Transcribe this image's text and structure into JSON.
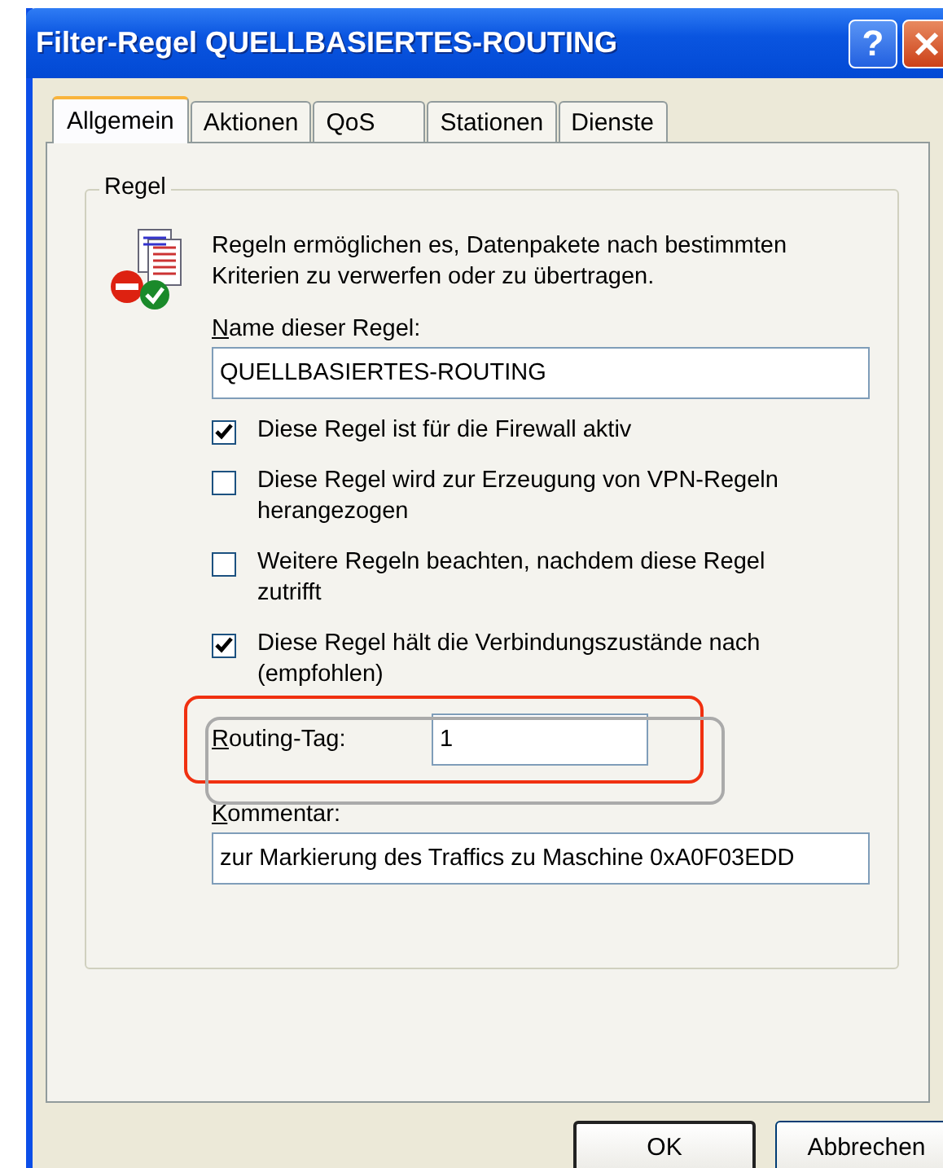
{
  "window": {
    "title": "Filter-Regel QUELLBASIERTES-ROUTING",
    "help": "?"
  },
  "tabs": [
    {
      "label": "Allgemein",
      "selected": true
    },
    {
      "label": "Aktionen",
      "selected": false
    },
    {
      "label": "QoS",
      "selected": false
    },
    {
      "label": "Stationen",
      "selected": false
    },
    {
      "label": "Dienste",
      "selected": false
    }
  ],
  "group": {
    "title": "Regel",
    "description": "Regeln ermöglichen es, Datenpakete nach bestimmten Kriterien zu verwerfen oder zu übertragen.",
    "name_field": {
      "label": "Name dieser Regel:",
      "value": "QUELLBASIERTES-ROUTING"
    },
    "checkboxes": [
      {
        "label": "Diese Regel ist für die Firewall aktiv",
        "checked": true
      },
      {
        "label": "Diese Regel wird zur Erzeugung von VPN-Regeln herangezogen",
        "checked": false
      },
      {
        "label": "Weitere Regeln beachten, nachdem diese Regel zutrifft",
        "checked": false
      },
      {
        "label": "Diese Regel hält die Verbindungszustände nach (empfohlen)",
        "checked": true
      }
    ],
    "routing_tag": {
      "label": "Routing-Tag:",
      "value": "1"
    },
    "comment": {
      "label": "Kommentar:",
      "value": "zur Markierung des Traffics zu Maschine 0xA0F03EDD"
    }
  },
  "buttons": [
    {
      "label": "OK",
      "default": true
    },
    {
      "label": "Abbrechen",
      "default": false
    }
  ]
}
